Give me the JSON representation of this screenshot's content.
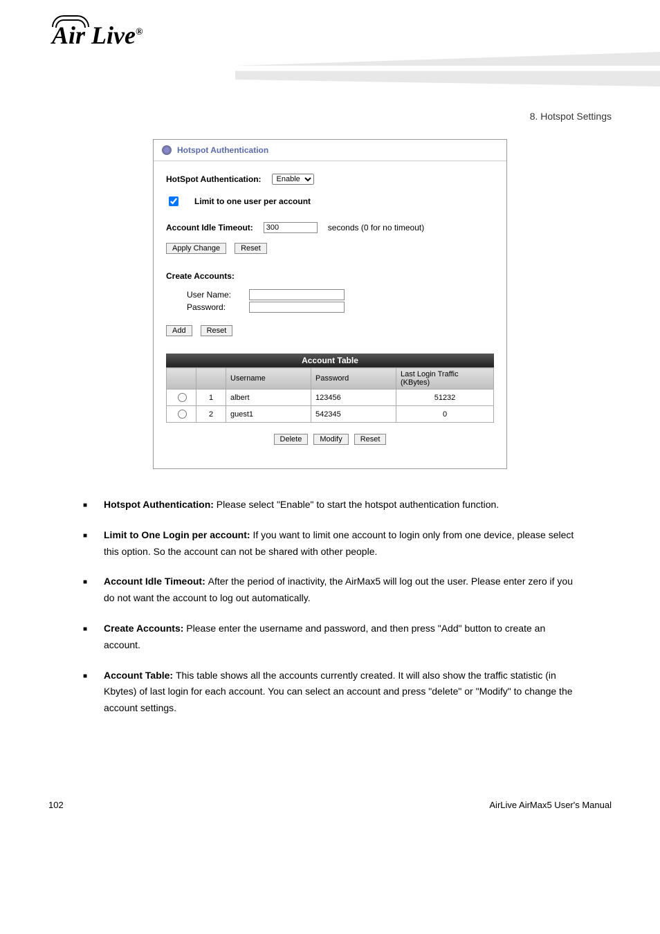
{
  "chapter_header": "8. Hotspot Settings",
  "panel": {
    "title": "Hotspot Authentication",
    "auth_label": "HotSpot Authentication:",
    "auth_value": "Enable",
    "limit_label": "Limit to one user per account",
    "timeout_label": "Account Idle Timeout:",
    "timeout_value": "300",
    "timeout_suffix": "seconds (0 for no timeout)",
    "apply_btn": "Apply Change",
    "reset_btn": "Reset",
    "create_label": "Create Accounts:",
    "username_label": "User Name:",
    "password_label": "Password:",
    "add_btn": "Add",
    "reset_btn2": "Reset",
    "table_title": "Account Table",
    "headers": {
      "username": "Username",
      "password": "Password",
      "traffic": "Last Login Traffic (KBytes)"
    },
    "rows": [
      {
        "num": "1",
        "user": "albert",
        "pass": "123456",
        "traffic": "51232"
      },
      {
        "num": "2",
        "user": "guest1",
        "pass": "542345",
        "traffic": "0"
      }
    ],
    "delete_btn": "Delete",
    "modify_btn": "Modify",
    "reset_btn3": "Reset"
  },
  "items": [
    {
      "bold": "Hotspot Authentication: ",
      "text": "Please select \"Enable\" to start the hotspot authentication function."
    },
    {
      "bold": "Limit to One Login per account: ",
      "text": "If you want to limit one account to login only from one device, please select this option. So the account can not be shared with other people."
    },
    {
      "bold": "Account Idle Timeout: ",
      "text": "After the period of inactivity, the AirMax5 will log out the user. Please enter zero if you do not want the account to log out automatically."
    },
    {
      "bold": "Create Accounts: ",
      "text": "Please enter the username and password, and then press \"Add\" button to create an account."
    },
    {
      "bold": "Account Table: ",
      "text": "This table shows all the accounts currently created. It will also show the traffic statistic (in Kbytes) of last login for each account. You can select an account and press \"delete\" or \"Modify\" to change the account settings."
    }
  ],
  "footer": {
    "page": "102",
    "manual": "AirLive AirMax5 User's Manual"
  }
}
